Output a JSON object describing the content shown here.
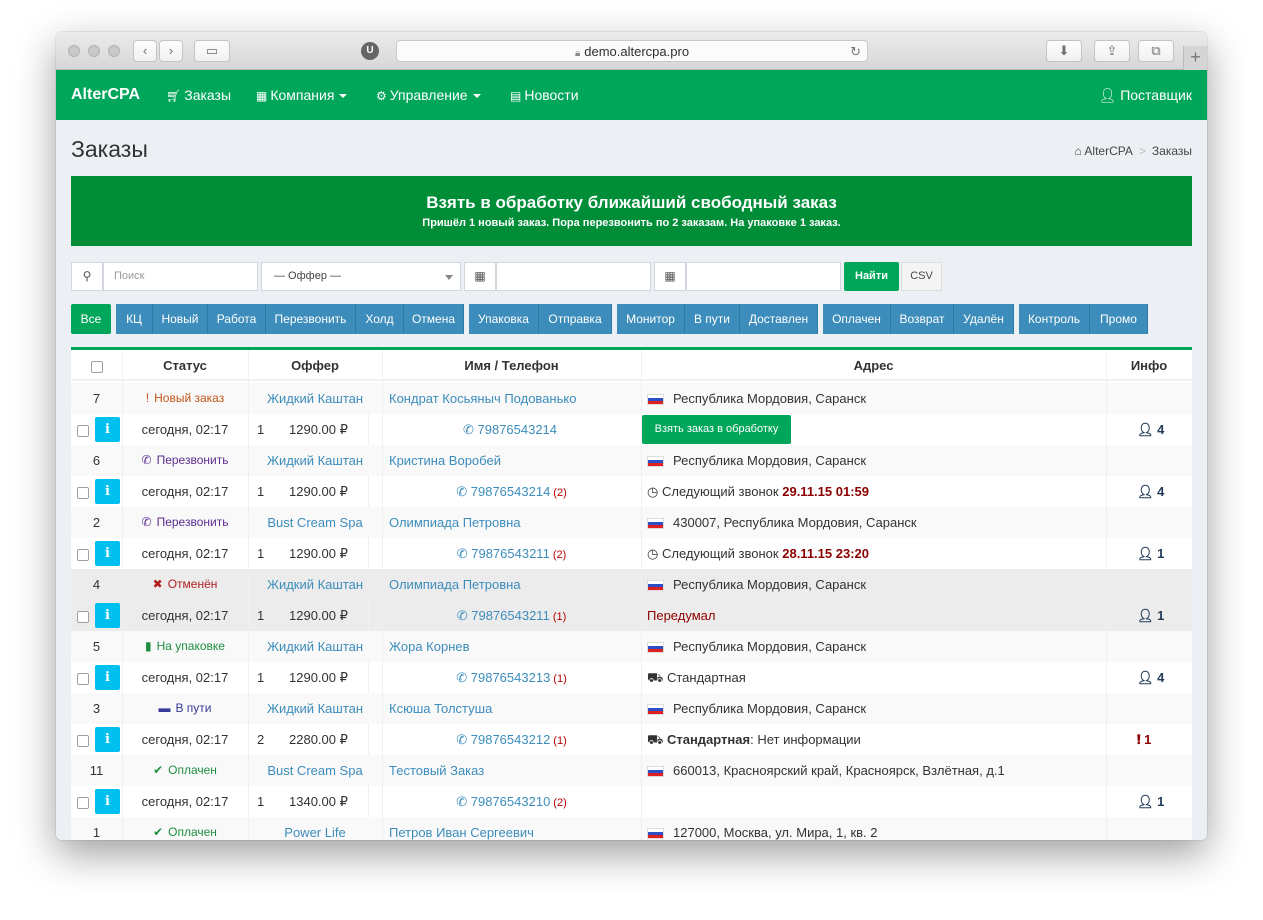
{
  "browser": {
    "url": "demo.altercpa.pro",
    "extension_badge": "U",
    "new_tab": "+"
  },
  "navbar": {
    "brand": "AlterCPA",
    "items": [
      {
        "label": "Заказы",
        "icon": "cart-icon"
      },
      {
        "label": "Компания",
        "icon": "building-icon"
      },
      {
        "label": "Управление",
        "icon": "gears-icon"
      },
      {
        "label": "Новости",
        "icon": "newspaper-icon"
      }
    ],
    "user": "Поставщик"
  },
  "page": {
    "title": "Заказы",
    "breadcrumb_home": "AlterCPA",
    "breadcrumb_current": "Заказы"
  },
  "callout": {
    "title": "Взять в обработку ближайший свободный заказ",
    "subtitle": "Пришёл 1 новый заказ. Пора перезвонить по 2 заказам. На упаковке 1 заказ."
  },
  "filter": {
    "search_placeholder": "Поиск",
    "offer_placeholder": "— Оффер —",
    "find_label": "Найти",
    "csv_label": "CSV"
  },
  "status_buttons": [
    "Все",
    "КЦ",
    "Новый",
    "Работа",
    "Перезвонить",
    "Холд",
    "Отмена",
    "Упаковка",
    "Отправка",
    "Монитор",
    "В пути",
    "Доставлен",
    "Оплачен",
    "Возврат",
    "Удалён",
    "Контроль",
    "Промо"
  ],
  "table": {
    "headers": {
      "status": "Статус",
      "offer": "Оффер",
      "name_phone": "Имя / Телефон",
      "address": "Адрес",
      "info": "Инфо"
    },
    "orders": [
      {
        "id": "7",
        "status": "Новый заказ",
        "status_icon": "!",
        "status_color": "#c2561a",
        "offer": "Жидкий Каштан",
        "name": "Кондрат Косьяныч Подованько",
        "address": "Республика Мордовия, Саранск",
        "date": "сегодня, 02:17",
        "qty": "1",
        "price": "1290.00 ₽",
        "phone": "79876543214",
        "calls": "",
        "note_type": "button",
        "note_label": "",
        "note_value": "",
        "button_label": "Взять заказ в обработку",
        "info": "4",
        "info_icon": "user",
        "gray": false
      },
      {
        "id": "6",
        "status": "Перезвонить",
        "status_icon": "✆",
        "status_color": "#5c2d91",
        "offer": "Жидкий Каштан",
        "name": "Кристина Воробей",
        "address": "Республика Мордовия, Саранск",
        "date": "сегодня, 02:17",
        "qty": "1",
        "price": "1290.00 ₽",
        "phone": "79876543214",
        "calls": "(2)",
        "note_type": "call",
        "note_label": "Следующий звонок",
        "note_value": "29.11.15 01:59",
        "button_label": "",
        "info": "4",
        "info_icon": "user",
        "gray": false
      },
      {
        "id": "2",
        "status": "Перезвонить",
        "status_icon": "✆",
        "status_color": "#5c2d91",
        "offer": "Bust Cream Spa",
        "name": "Олимпиада Петровна",
        "address": "430007, Республика Мордовия, Саранск",
        "date": "сегодня, 02:17",
        "qty": "1",
        "price": "1290.00 ₽",
        "phone": "79876543211",
        "calls": "(2)",
        "note_type": "call",
        "note_label": "Следующий звонок",
        "note_value": "28.11.15 23:20",
        "button_label": "",
        "info": "1",
        "info_icon": "user",
        "gray": false
      },
      {
        "id": "4",
        "status": "Отменён",
        "status_icon": "✖",
        "status_color": "#b01e1e",
        "offer": "Жидкий Каштан",
        "name": "Олимпиада Петровна",
        "address": "Республика Мордовия, Саранск",
        "date": "сегодня, 02:17",
        "qty": "1",
        "price": "1290.00 ₽",
        "phone": "79876543211",
        "calls": "(1)",
        "note_type": "reason",
        "note_label": "Передумал",
        "note_value": "",
        "button_label": "",
        "info": "1",
        "info_icon": "user",
        "gray": true
      },
      {
        "id": "5",
        "status": "На упаковке",
        "status_icon": "▮",
        "status_color": "#1e8f3e",
        "offer": "Жидкий Каштан",
        "name": "Жора Корнев",
        "address": "Республика Мордовия, Саранск",
        "date": "сегодня, 02:17",
        "qty": "1",
        "price": "1290.00 ₽",
        "phone": "79876543213",
        "calls": "(1)",
        "note_type": "delivery",
        "note_label": "Стандартная",
        "note_value": "",
        "button_label": "",
        "info": "4",
        "info_icon": "user",
        "gray": false
      },
      {
        "id": "3",
        "status": "В пути",
        "status_icon": "▬",
        "status_color": "#3a3a9a",
        "offer": "Жидкий Каштан",
        "name": "Ксюша Толстуша",
        "address": "Республика Мордовия, Саранск",
        "date": "сегодня, 02:17",
        "qty": "2",
        "price": "2280.00 ₽",
        "phone": "79876543212",
        "calls": "(1)",
        "note_type": "delivery_info",
        "note_label": "Стандартная",
        "note_value": ": Нет информации",
        "button_label": "",
        "info": "1",
        "info_icon": "alert",
        "gray": false
      },
      {
        "id": "11",
        "status": "Оплачен",
        "status_icon": "✔",
        "status_color": "#1e8f3e",
        "offer": "Bust Cream Spa",
        "name": "Тестовый Заказ",
        "address": "660013, Красноярский край, Красноярск, Взлётная, д.1",
        "date": "сегодня, 02:17",
        "qty": "1",
        "price": "1340.00 ₽",
        "phone": "79876543210",
        "calls": "(2)",
        "note_type": "none",
        "note_label": "",
        "note_value": "",
        "button_label": "",
        "info": "1",
        "info_icon": "user",
        "gray": false
      },
      {
        "id": "1",
        "status": "Оплачен",
        "status_icon": "✔",
        "status_color": "#1e8f3e",
        "offer": "Power Life",
        "name": "Петров Иван Сергеевич",
        "address": "127000, Москва, ул. Мира, 1, кв. 2",
        "date": "",
        "qty": "",
        "price": "",
        "phone": "",
        "calls": "",
        "note_type": "none",
        "note_label": "",
        "note_value": "",
        "button_label": "",
        "info": "",
        "info_icon": "",
        "gray": false
      }
    ]
  }
}
